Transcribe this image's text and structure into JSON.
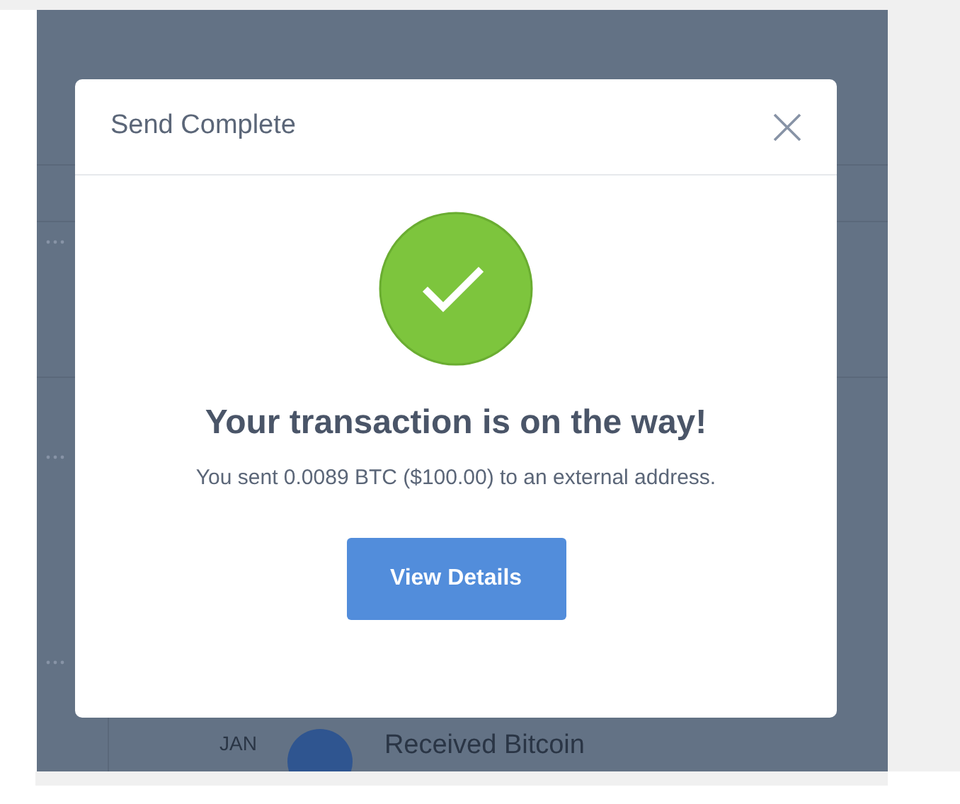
{
  "dialog": {
    "title": "Send Complete",
    "heading": "Your transaction is on the way!",
    "message": "You sent 0.0089 BTC ($100.00) to an external address.",
    "button": "View Details"
  },
  "background_row": {
    "month": "JAN",
    "title": "Received Bitcoin"
  }
}
